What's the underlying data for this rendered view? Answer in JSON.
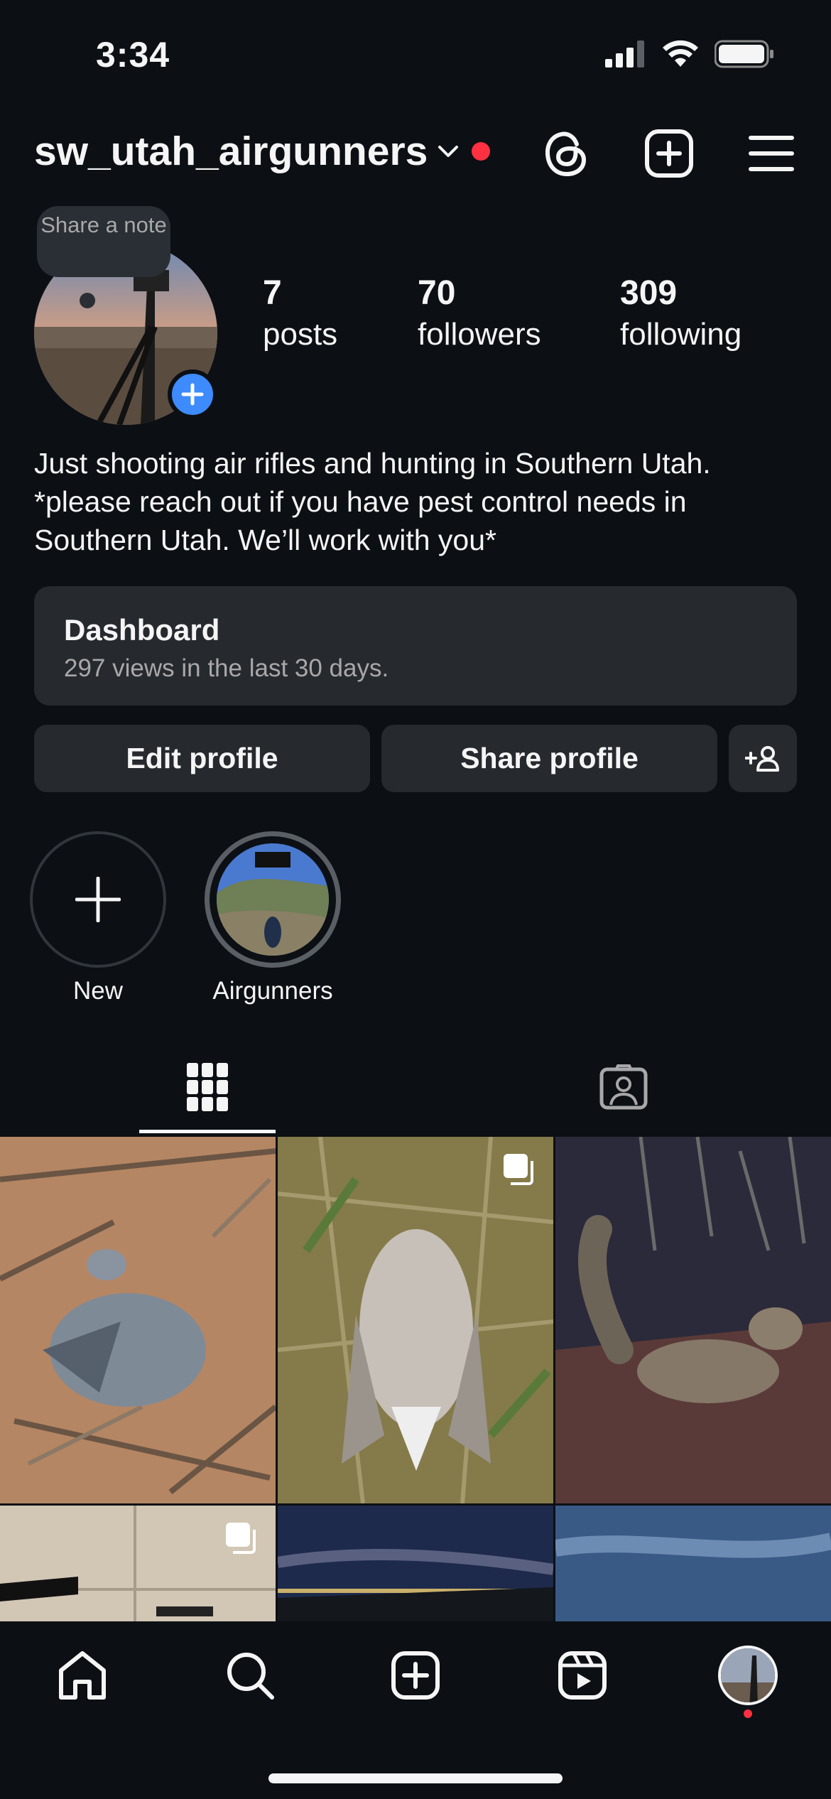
{
  "status_bar": {
    "time": "3:34"
  },
  "header": {
    "username": "sw_utah_airgunners"
  },
  "profile": {
    "note_text": "Share a note",
    "stats": [
      {
        "num": "7",
        "label": "posts"
      },
      {
        "num": "70",
        "label": "followers"
      },
      {
        "num": "309",
        "label": "following"
      }
    ],
    "bio": [
      "Just shooting air rifles and hunting in Southern Utah.",
      "*please reach out if you have pest control needs in",
      "Southern Utah. We’ll work with you*"
    ]
  },
  "dashboard": {
    "title": "Dashboard",
    "subtitle": "297 views in the last 30 days."
  },
  "buttons": {
    "edit": "Edit profile",
    "share": "Share profile"
  },
  "highlights": [
    {
      "label": "New"
    },
    {
      "label": "Airgunners"
    }
  ],
  "colors": {
    "background": "#0c1014",
    "surface": "#262a2f",
    "accent": "#3d8bfd",
    "notification": "#ff3040"
  }
}
